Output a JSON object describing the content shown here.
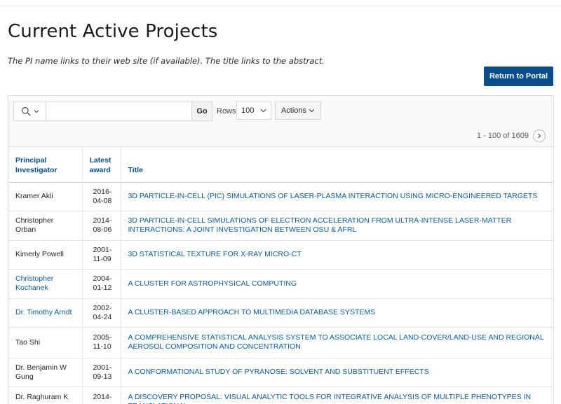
{
  "page": {
    "title": "Current Active Projects",
    "intro": "The PI name links to their web site (if available). The title links to the abstract.",
    "return_button": "Return to Portal"
  },
  "toolbar": {
    "search_value": "",
    "go_label": "Go",
    "rows_label": "Rows",
    "rows_value": "100",
    "actions_label": "Actions"
  },
  "pagination": {
    "label": "1 - 100 of 1609"
  },
  "table": {
    "headers": {
      "pi_line1": "Principal",
      "pi_line2": "Investigator",
      "award_line1": "Latest",
      "award_line2": "award",
      "title": "Title"
    },
    "rows": [
      {
        "pi": "Kramer Akli",
        "pi_linked": false,
        "date_year": "2016-",
        "date_rest": "04-08",
        "title": "3D PARTICLE-IN-CELL (PIC) SIMULATIONS OF LASER-PLASMA INTERACTION USING MICRO-ENGINEERED TARGETS"
      },
      {
        "pi": "Christopher Orban",
        "pi_linked": false,
        "date_year": "2014-",
        "date_rest": "08-06",
        "title": "3D PARTICLE-IN-CELL SIMULATIONS OF ELECTRON ACCELERATION FROM ULTRA-INTENSE LASER-MATTER INTERACTIONS: A JOINT INVESTIGATION BETWEEN OSU & AFRL"
      },
      {
        "pi": "Kimerly Powell",
        "pi_linked": false,
        "date_year": "2001-",
        "date_rest": "11-09",
        "title": "3D STATISTICAL TEXTURE FOR X-RAY MICRO-CT"
      },
      {
        "pi": "Christopher Kochanek",
        "pi_linked": true,
        "date_year": "2004-",
        "date_rest": "01-12",
        "title": "A CLUSTER FOR ASTROPHYSICAL COMPUTING"
      },
      {
        "pi": "Dr. Timothy Arndt",
        "pi_linked": true,
        "date_year": "2002-",
        "date_rest": "04-24",
        "title": "A CLUSTER-BASED APPROACH TO MULTIMEDIA DATABASE SYSTEMS"
      },
      {
        "pi": "Tao Shi",
        "pi_linked": false,
        "date_year": "2005-",
        "date_rest": "11-10",
        "title": "A COMPREHENSIVE STATISTICAL ANALYSIS SYSTEM TO ASSOCIATE LOCAL LAND-COVER/LAND-USE AND REGIONAL AEROSOL COMPOSITION AND CONCENTRATION"
      },
      {
        "pi": "Dr. Benjamin W Gung",
        "pi_linked": false,
        "date_year": "2001-",
        "date_rest": "09-13",
        "title": "A CONFORMATIONAL STUDY OF PYRANOSE: SOLVENT AND SUBSTITUENT EFFECTS"
      },
      {
        "pi": "Dr. Raghuram K",
        "pi_linked": false,
        "date_year": "2014-",
        "date_rest": "",
        "title": "A DISCOVERY PROPOSAL: VISUAL ANALYTIC TOOLS FOR INTEGRATIVE ANALYSIS OF MULTIPLE PHENOTYPES IN TRANSLATIONAL"
      }
    ]
  },
  "icons": {
    "search": "search-icon",
    "chevron": "chevron-down-icon",
    "next": "chevron-right-icon"
  },
  "colors": {
    "accent": "#0a4d8c",
    "link": "#0a5aa0"
  }
}
